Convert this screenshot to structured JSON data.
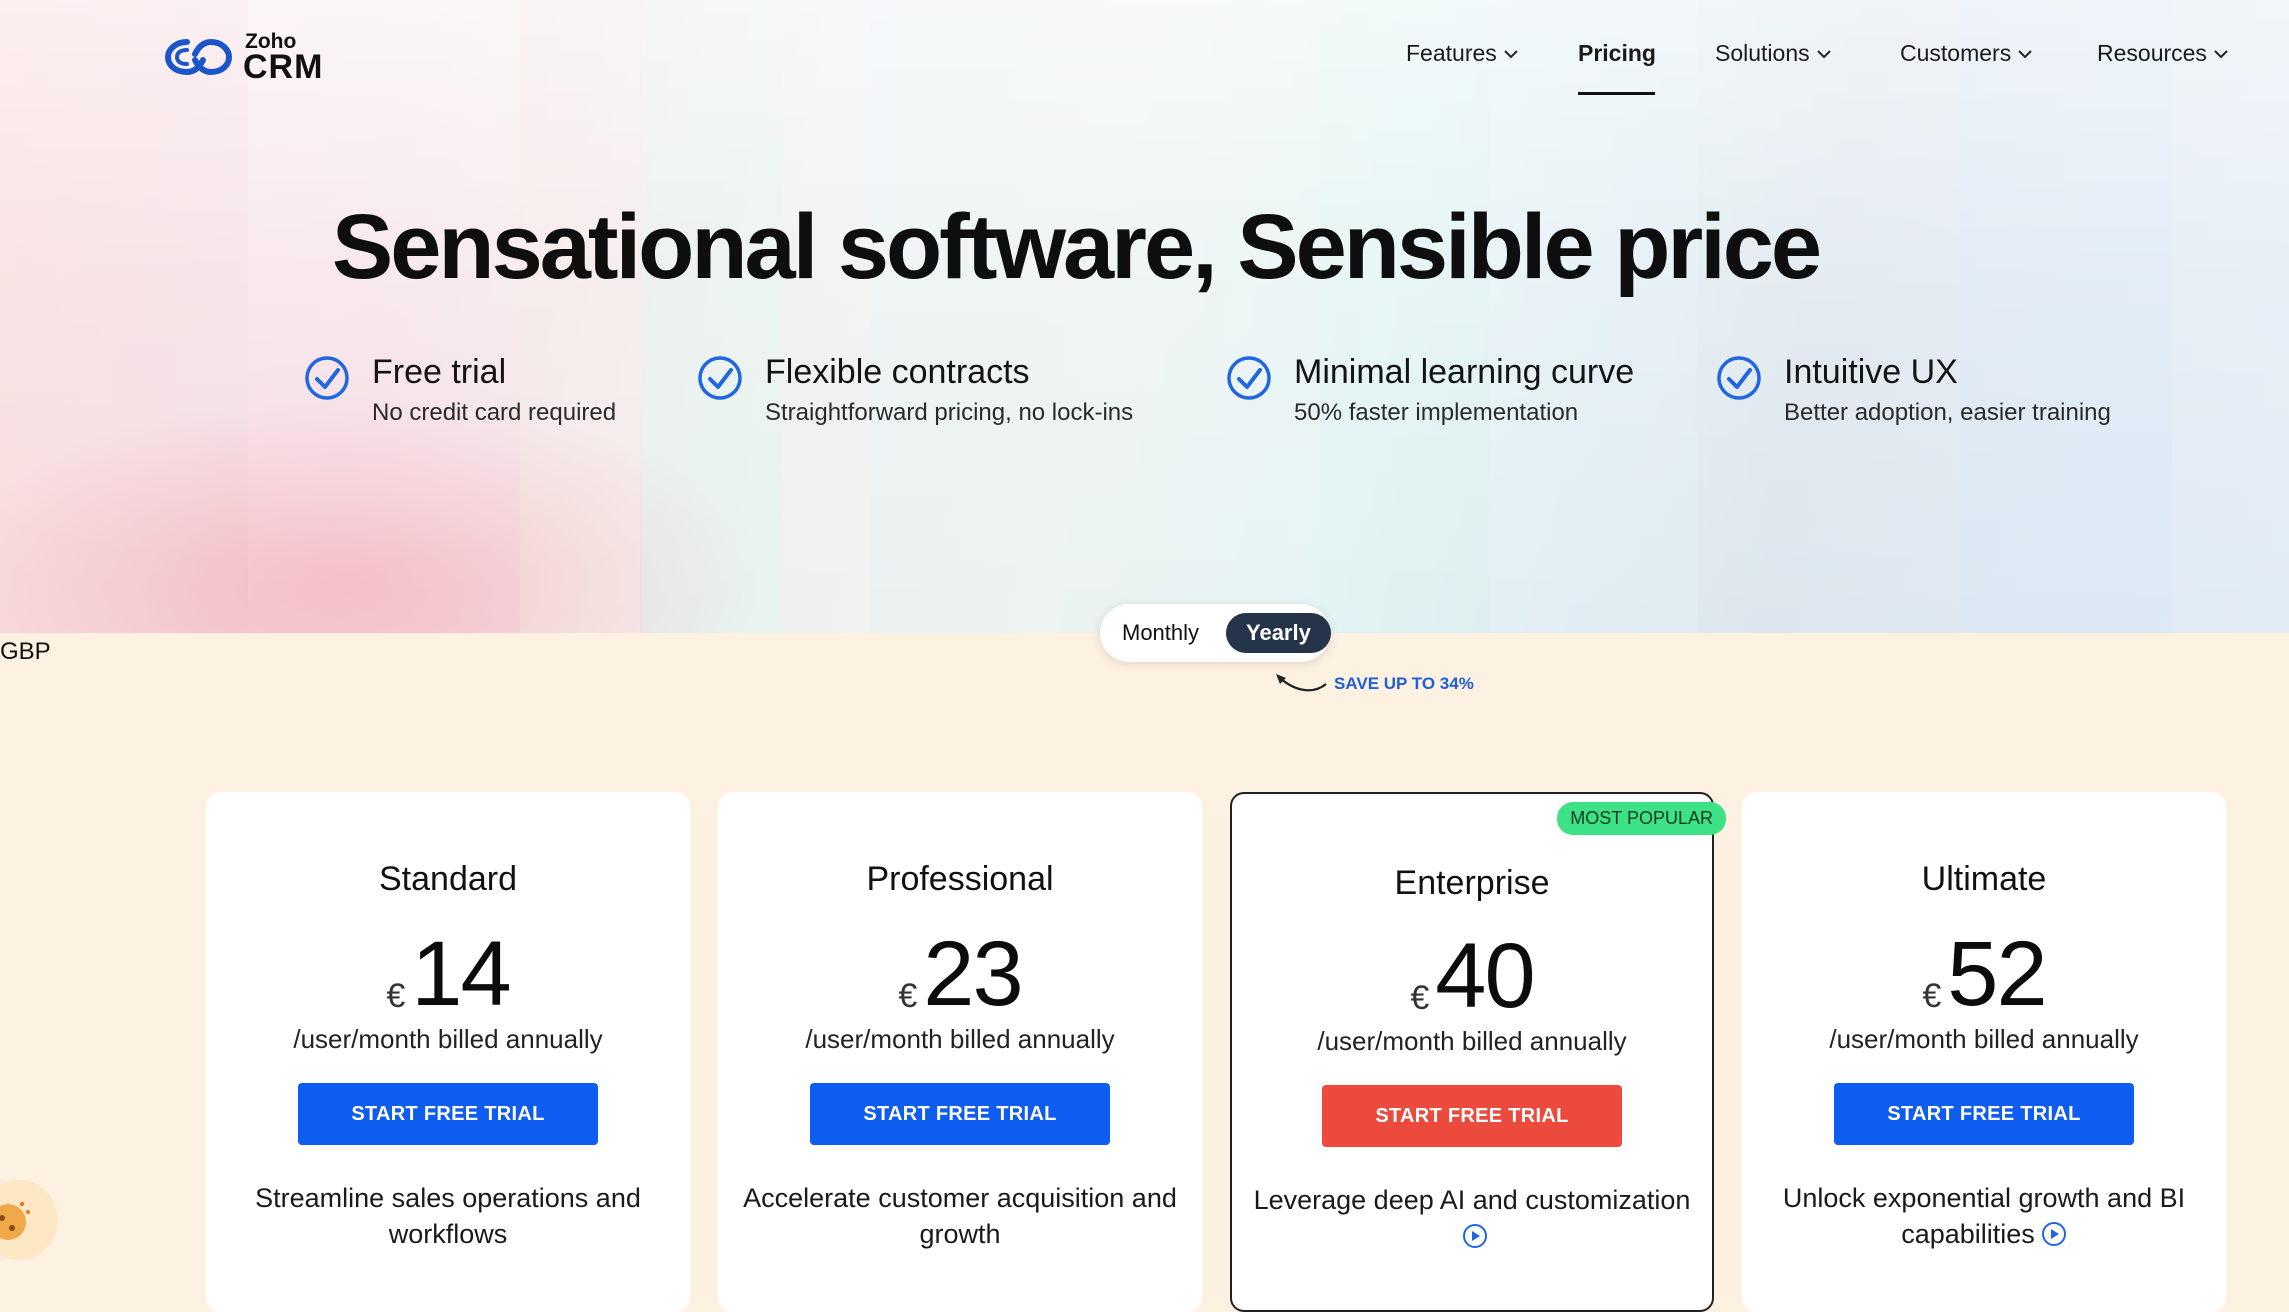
{
  "brand": {
    "small": "Zoho",
    "big": "CRM"
  },
  "nav": [
    {
      "label": "Features",
      "dropdown": true
    },
    {
      "label": "Pricing",
      "dropdown": false,
      "active": true
    },
    {
      "label": "Solutions",
      "dropdown": true
    },
    {
      "label": "Customers",
      "dropdown": true
    },
    {
      "label": "Resources",
      "dropdown": true
    }
  ],
  "hero": {
    "title": "Sensational software, Sensible price",
    "features": [
      {
        "title": "Free trial",
        "subtitle": "No credit card required"
      },
      {
        "title": "Flexible contracts",
        "subtitle": "Straightforward pricing, no lock-ins"
      },
      {
        "title": "Minimal learning curve",
        "subtitle": "50% faster implementation"
      },
      {
        "title": "Intuitive UX",
        "subtitle": "Better adoption, easier training"
      }
    ]
  },
  "currency_label": "GBP",
  "billing_toggle": {
    "monthly": "Monthly",
    "yearly": "Yearly",
    "selected": "Yearly",
    "save_note": "SAVE UP TO 34%"
  },
  "plans": [
    {
      "name": "Standard",
      "currency": "€",
      "price": "14",
      "billing": "/user/month billed annually",
      "cta": "START FREE TRIAL",
      "description": "Streamline sales operations and workflows",
      "popular": false
    },
    {
      "name": "Professional",
      "currency": "€",
      "price": "23",
      "billing": "/user/month billed annually",
      "cta": "START FREE TRIAL",
      "description": "Accelerate customer acquisition and growth",
      "popular": false
    },
    {
      "name": "Enterprise",
      "currency": "€",
      "price": "40",
      "billing": "/user/month billed annually",
      "cta": "START FREE TRIAL",
      "description": "Leverage deep AI and customization",
      "popular": true,
      "badge": "MOST POPULAR"
    },
    {
      "name": "Ultimate",
      "currency": "€",
      "price": "52",
      "billing": "/user/month billed annually",
      "cta": "START FREE TRIAL",
      "description": "Unlock exponential growth and BI capabilities",
      "popular": false
    }
  ],
  "colors": {
    "primary_cta": "#0f5cf0",
    "popular_cta": "#eb4a3d",
    "badge": "#3ce285",
    "check": "#1f66e0",
    "page_bg": "#fdf1e2"
  },
  "icons": {
    "feature_check": "check-circle-icon",
    "dropdown": "chevron-down-icon",
    "info": "play-circle-icon",
    "cookie": "cookie-icon"
  }
}
